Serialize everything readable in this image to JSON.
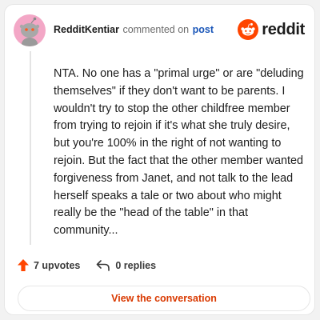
{
  "comment": {
    "username": "RedditKentiar",
    "action_text": "commented on",
    "target_link": "post",
    "body": "NTA. No one has a \"primal urge\" or are \"deluding themselves\" if they don't want to be parents. I wouldn't try to stop the other childfree member from trying to rejoin if it's what she truly desire, but you're 100% in the right of not wanting to rejoin. But the fact that the other member wanted forgiveness from Janet, and not talk to the lead herself speaks a tale or two about who might really be the \"head of the table\" in that community..."
  },
  "brand": {
    "wordmark": "reddit",
    "icon": "reddit-alien-icon",
    "color": "#ff4500"
  },
  "stats": {
    "upvotes": "7 upvotes",
    "replies": "0 replies",
    "upvote_icon": "upvote-arrow-icon",
    "reply_icon": "reply-arrow-icon"
  },
  "cta": {
    "label": "View the conversation",
    "color": "#d93900"
  },
  "colors": {
    "avatar_bg": "#f3a7c6",
    "link": "#1a56b8"
  }
}
